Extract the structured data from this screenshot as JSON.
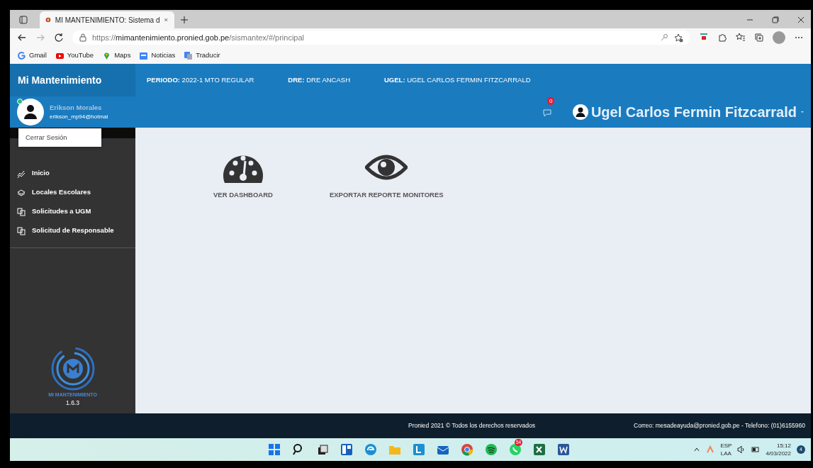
{
  "browser": {
    "tab_title": "MI MANTENIMIENTO: Sistema d",
    "url_host": "mimantenimiento.pronied.gob.pe",
    "url_scheme": "https://",
    "url_path": "/sismantex/#/principal",
    "bookmarks": [
      {
        "label": "Gmail",
        "kind": "gmail"
      },
      {
        "label": "YouTube",
        "kind": "youtube"
      },
      {
        "label": "Maps",
        "kind": "maps"
      },
      {
        "label": "Noticias",
        "kind": "news"
      },
      {
        "label": "Traducir",
        "kind": "translate"
      }
    ]
  },
  "app": {
    "brand": "Mi Mantenimiento",
    "info": [
      {
        "label": "PERIODO:",
        "value": "2022-1 MTO REGULAR"
      },
      {
        "label": "DRE:",
        "value": "DRE ANCASH"
      },
      {
        "label": "UGEL:",
        "value": "UGEL CARLOS FERMIN FITZCARRALD"
      }
    ],
    "user": {
      "name": "Erikson Morales",
      "email": "erikson_mp94@hotmai",
      "online": true
    },
    "notifications": {
      "count": "0"
    },
    "account": {
      "name": "Ugel Carlos Fermin Fitzcarrald"
    },
    "user_menu": [
      {
        "label": "Cerrar Sesión"
      }
    ],
    "sidebar": {
      "items": [
        {
          "label": "Inicio",
          "kind": "chart"
        },
        {
          "label": "Locales Escolares",
          "kind": "layers"
        },
        {
          "label": "Solicitudes a UGM",
          "kind": "copy"
        },
        {
          "label": "Solicitud de Responsable",
          "kind": "copy"
        }
      ],
      "logo_text": "MI MANTENIMIENTO",
      "version": "1.6.3"
    },
    "actions": [
      {
        "label": "VER DASHBOARD",
        "kind": "gauge"
      },
      {
        "label": "EXPORTAR REPORTE MONITORES",
        "kind": "eye"
      }
    ],
    "footer": {
      "copyright": "Pronied 2021 © Todos los derechos reservados",
      "contact": "Correo: mesadeayuda@pronied.gob.pe - Telefono: (01)6155960"
    }
  },
  "taskbar": {
    "whatsapp_badge": "54",
    "lang": "ESP",
    "layout": "LAA",
    "time": "15:12",
    "date": "4/03/2022",
    "notif_count": "4"
  }
}
